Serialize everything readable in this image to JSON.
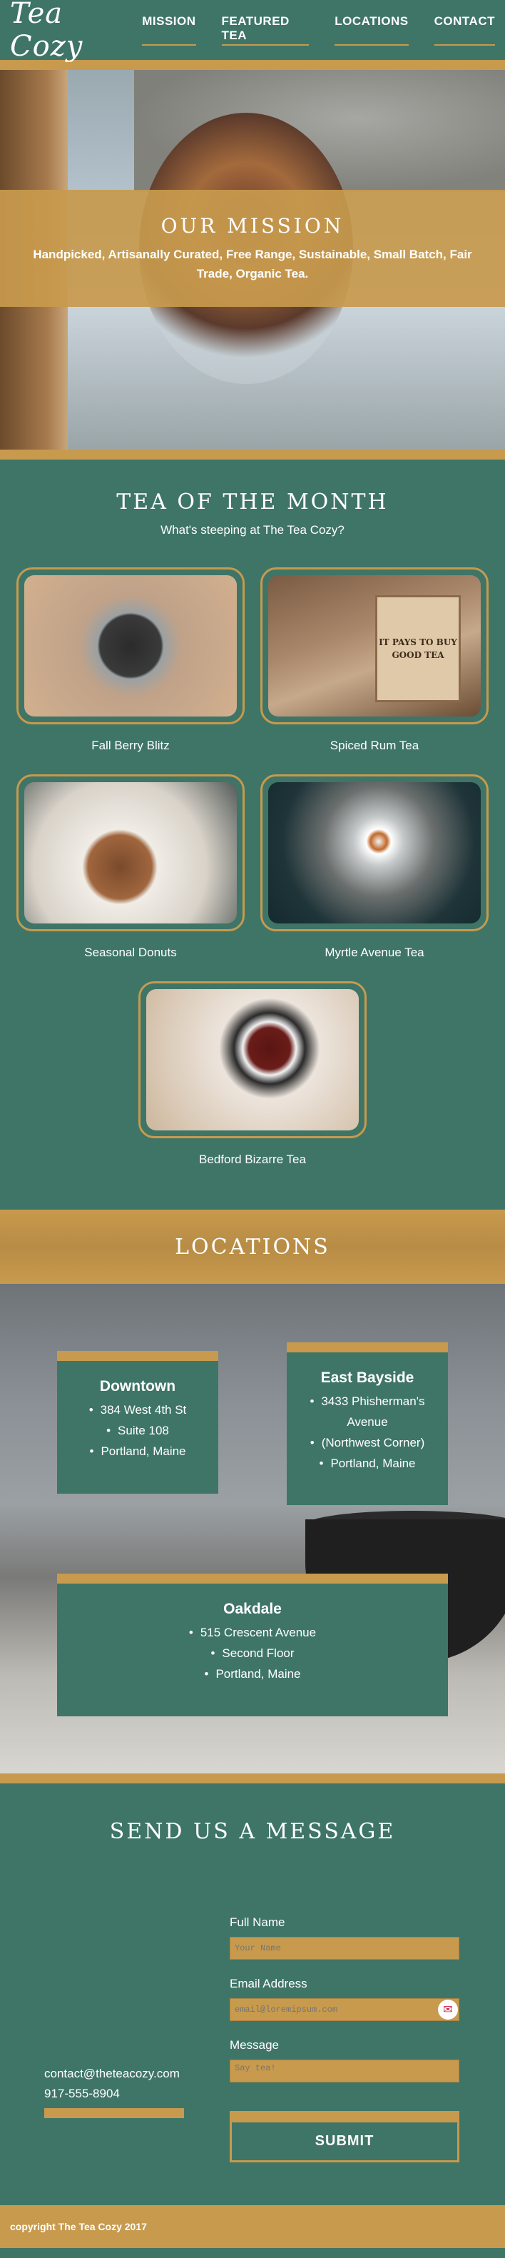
{
  "header": {
    "logo": "Tea Cozy",
    "nav": [
      "MISSION",
      "FEATURED TEA",
      "LOCATIONS",
      "CONTACT"
    ]
  },
  "mission": {
    "title": "OUR MISSION",
    "text": "Handpicked, Artisanally Curated, Free Range, Sustainable, Small Batch, Fair Trade, Organic Tea."
  },
  "tea_of_month": {
    "title": "TEA OF THE MONTH",
    "subtitle": "What's steeping at The Tea Cozy?",
    "teas": [
      {
        "name": "Fall Berry Blitz"
      },
      {
        "name": "Spiced Rum Tea",
        "box_text": "IT PAYS TO BUY GOOD TEA"
      },
      {
        "name": "Seasonal Donuts"
      },
      {
        "name": "Myrtle Avenue Tea"
      },
      {
        "name": "Bedford Bizarre Tea"
      }
    ]
  },
  "locations": {
    "title": "LOCATIONS",
    "cards": [
      {
        "name": "Downtown",
        "lines": [
          "384 West 4th St",
          "Suite 108",
          "Portland, Maine"
        ]
      },
      {
        "name": "East Bayside",
        "lines": [
          "3433 Phisherman's Avenue",
          "(Northwest Corner)",
          "Portland, Maine"
        ]
      },
      {
        "name": "Oakdale",
        "lines": [
          "515 Crescent Avenue",
          "Second Floor",
          "Portland, Maine"
        ]
      }
    ]
  },
  "contact": {
    "title": "SEND US A MESSAGE",
    "email": "contact@theteacozy.com",
    "phone": "917-555-8904",
    "form": {
      "name_label": "Full Name",
      "name_placeholder": "Your Name",
      "email_label": "Email Address",
      "email_placeholder": "email@loremipsum.com",
      "message_label": "Message",
      "message_placeholder": "Say tea!",
      "submit": "SUBMIT"
    }
  },
  "footer": {
    "text": "copyright The Tea Cozy 2017"
  },
  "colors": {
    "green": "#3f7567",
    "gold": "#c79a4e"
  }
}
